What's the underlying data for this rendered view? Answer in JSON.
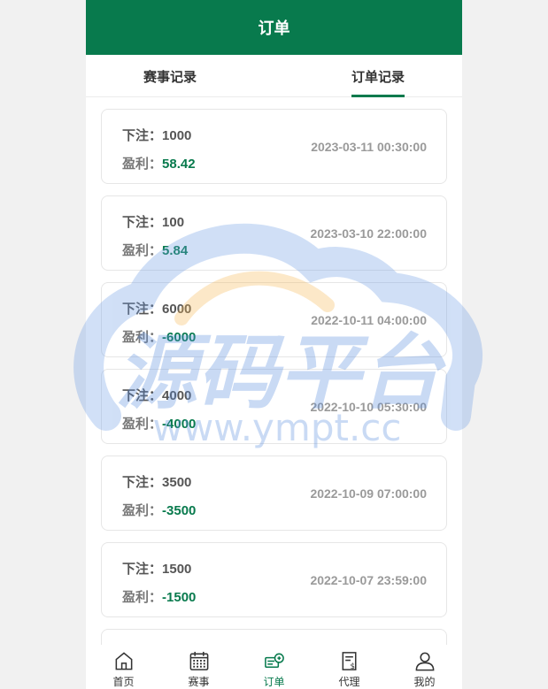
{
  "header": {
    "title": "订单"
  },
  "tabs": [
    {
      "label": "赛事记录",
      "active": false
    },
    {
      "label": "订单记录",
      "active": true
    }
  ],
  "labels": {
    "bet": "下注：",
    "profit": "盈利："
  },
  "orders": [
    {
      "bet": "1000",
      "profit": "58.42",
      "time": "2023-03-11 00:30:00"
    },
    {
      "bet": "100",
      "profit": "5.84",
      "time": "2023-03-10 22:00:00"
    },
    {
      "bet": "6000",
      "profit": "-6000",
      "time": "2022-10-11 04:00:00"
    },
    {
      "bet": "4000",
      "profit": "-4000",
      "time": "2022-10-10 05:30:00"
    },
    {
      "bet": "3500",
      "profit": "-3500",
      "time": "2022-10-09 07:00:00"
    },
    {
      "bet": "1500",
      "profit": "-1500",
      "time": "2022-10-07 23:59:00"
    },
    {
      "bet": "",
      "profit": "",
      "time": ""
    }
  ],
  "watermark": {
    "main": "源码平台",
    "sub": "www.ympt.cc"
  },
  "nav": [
    {
      "label": "首页",
      "icon": "home-icon",
      "active": false
    },
    {
      "label": "赛事",
      "icon": "calendar-icon",
      "active": false
    },
    {
      "label": "订单",
      "icon": "order-icon",
      "active": true
    },
    {
      "label": "代理",
      "icon": "agent-doc-icon",
      "active": false
    },
    {
      "label": "我的",
      "icon": "user-icon",
      "active": false
    }
  ],
  "colors": {
    "brand": "#087a4d",
    "background": "#f1f1f1"
  }
}
